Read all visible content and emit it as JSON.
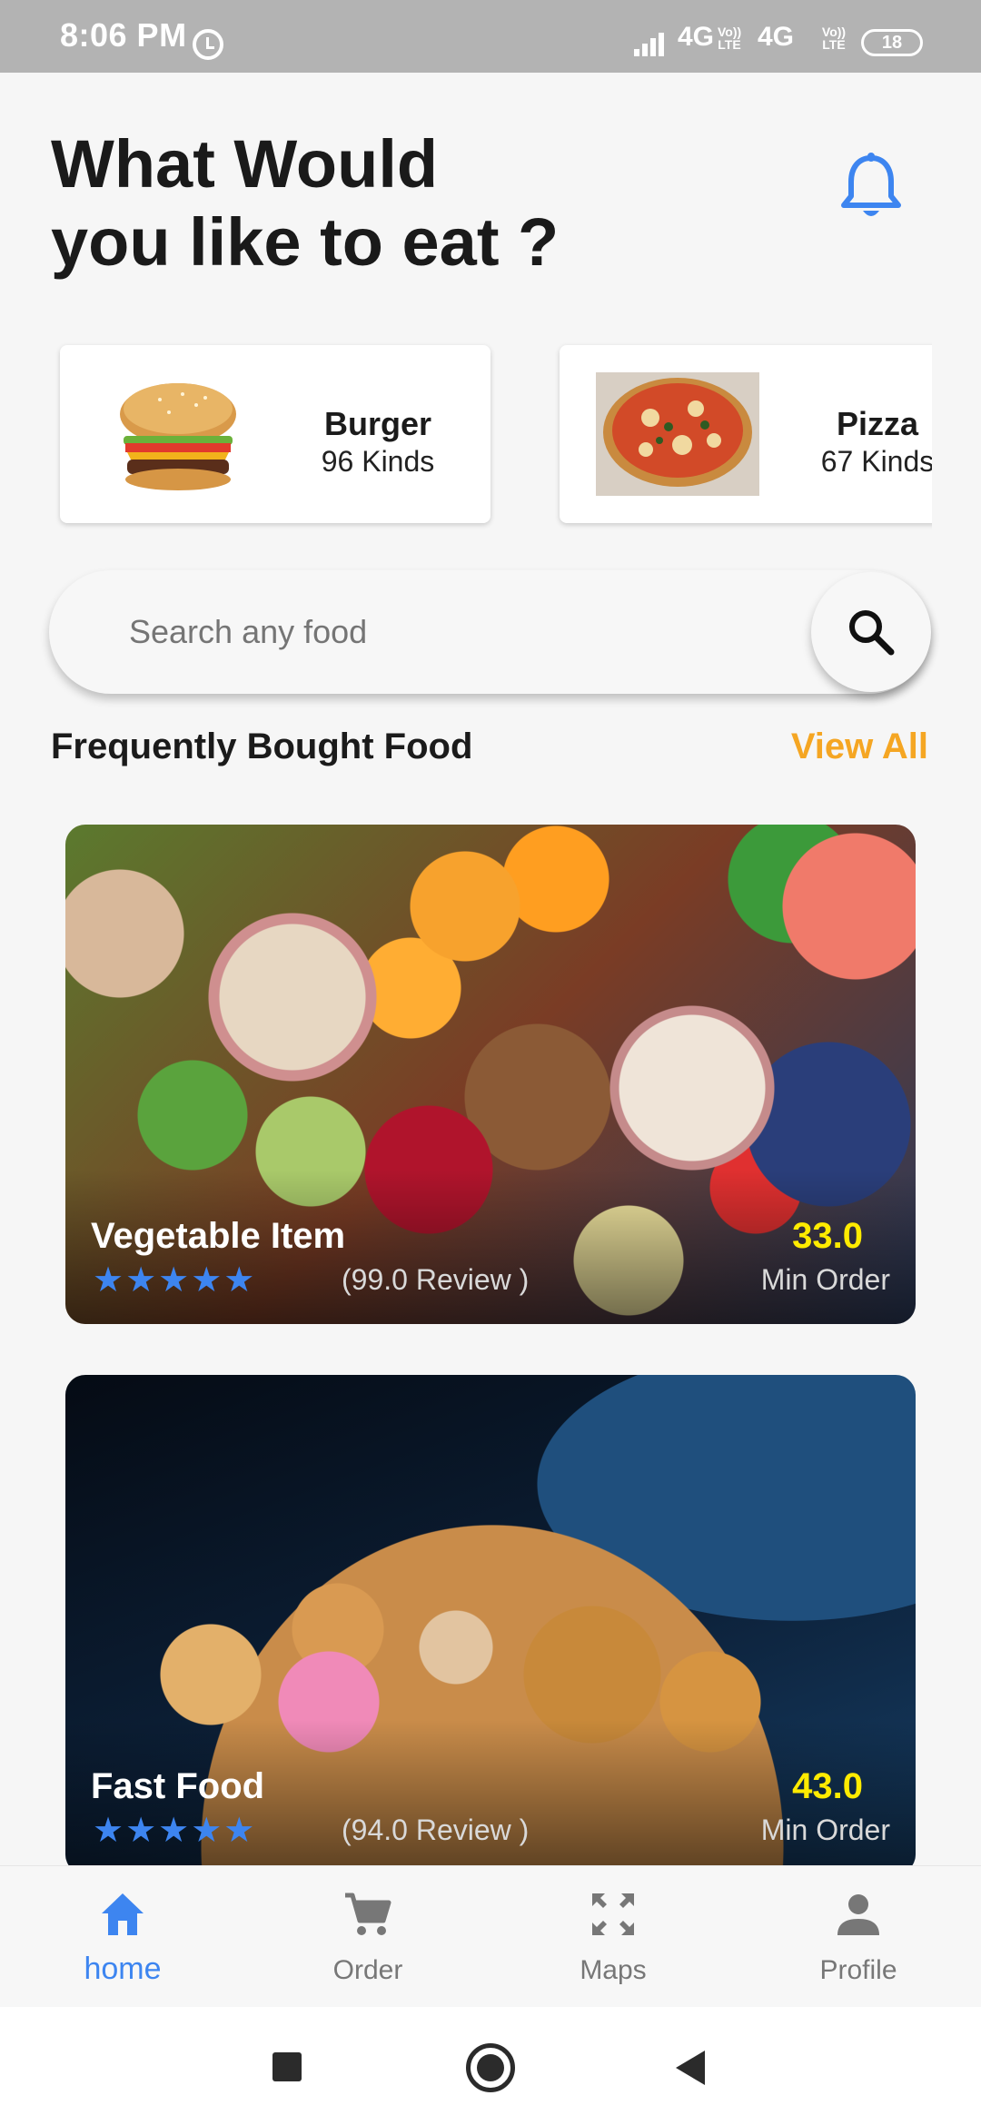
{
  "status_bar": {
    "time": "8:06 PM",
    "network_1": "4G",
    "network_2": "4G",
    "volte_1": "Vo)) LTE",
    "volte_2": "Vo)) LTE",
    "battery": "18",
    "icons": [
      "alarm-icon",
      "signal-icon",
      "battery-icon"
    ]
  },
  "header": {
    "title_line1": "What Would",
    "title_line2": "you like to eat ?",
    "bell_icon": "bell-icon",
    "bell_color": "#3d85f0"
  },
  "categories": [
    {
      "name": "Burger",
      "kinds": "96 Kinds"
    },
    {
      "name": "Pizza",
      "kinds": "67 Kinds"
    }
  ],
  "search": {
    "placeholder": "Search any food",
    "icon": "search-icon"
  },
  "section": {
    "title": "Frequently Bought Food",
    "view_all": "View All",
    "view_all_color": "#f5a623"
  },
  "foods": [
    {
      "name": "Vegetable Item",
      "stars": "★★★★★",
      "rating": 5,
      "reviews": "(99.0 Review )",
      "price": "33.0",
      "min_order": "Min Order"
    },
    {
      "name": "Fast Food",
      "stars": "★★★★★",
      "rating": 5,
      "reviews": "(94.0 Review )",
      "price": "43.0",
      "min_order": "Min Order"
    }
  ],
  "bottom_nav": {
    "active_color": "#3d85f0",
    "items": [
      {
        "label": "home",
        "icon": "home-icon",
        "active": true
      },
      {
        "label": "Order",
        "icon": "cart-icon",
        "active": false
      },
      {
        "label": "Maps",
        "icon": "fullscreen-icon",
        "active": false
      },
      {
        "label": "Profile",
        "icon": "person-icon",
        "active": false
      }
    ]
  },
  "system_nav": {
    "buttons": [
      "recents-button",
      "home-button",
      "back-button"
    ]
  }
}
